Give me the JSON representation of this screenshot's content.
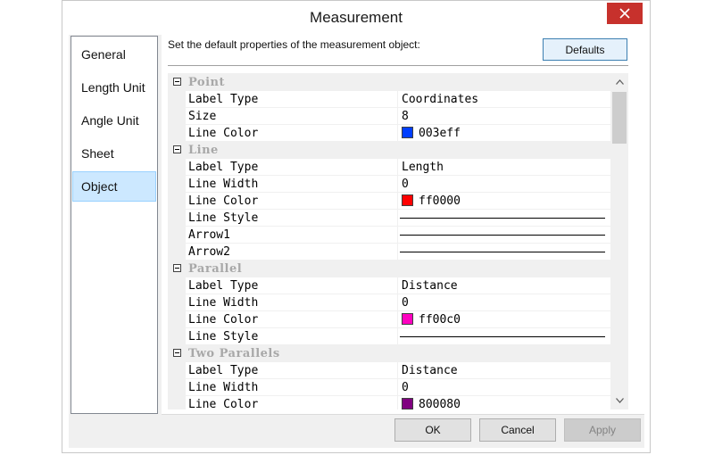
{
  "window": {
    "title": "Measurement"
  },
  "nav": {
    "items": [
      {
        "label": "General",
        "selected": false
      },
      {
        "label": "Length Unit",
        "selected": false
      },
      {
        "label": "Angle Unit",
        "selected": false
      },
      {
        "label": "Sheet",
        "selected": false
      },
      {
        "label": "Object",
        "selected": true
      }
    ]
  },
  "header": {
    "description": "Set the default properties of the measurement object:",
    "defaults_label": "Defaults"
  },
  "property_grid": {
    "rows": [
      {
        "kind": "category",
        "name": "Point"
      },
      {
        "kind": "property",
        "name": "Label Type",
        "value": "Coordinates"
      },
      {
        "kind": "property",
        "name": "Size",
        "value": "8"
      },
      {
        "kind": "property",
        "name": "Line Color",
        "value": "003eff",
        "color": "#003eff"
      },
      {
        "kind": "category",
        "name": "Line"
      },
      {
        "kind": "property",
        "name": "Label Type",
        "value": "Length"
      },
      {
        "kind": "property",
        "name": "Line Width",
        "value": "0"
      },
      {
        "kind": "property",
        "name": "Line Color",
        "value": "ff0000",
        "color": "#ff0000"
      },
      {
        "kind": "property",
        "name": "Line Style",
        "value": "",
        "line": "solid"
      },
      {
        "kind": "property",
        "name": "Arrow1",
        "value": "",
        "line": "solid"
      },
      {
        "kind": "property",
        "name": "Arrow2",
        "value": "",
        "line": "solid"
      },
      {
        "kind": "category",
        "name": "Parallel"
      },
      {
        "kind": "property",
        "name": "Label Type",
        "value": "Distance"
      },
      {
        "kind": "property",
        "name": "Line Width",
        "value": "0"
      },
      {
        "kind": "property",
        "name": "Line Color",
        "value": "ff00c0",
        "color": "#ff00c0"
      },
      {
        "kind": "property",
        "name": "Line Style",
        "value": "",
        "line": "solid"
      },
      {
        "kind": "category",
        "name": "Two Parallels"
      },
      {
        "kind": "property",
        "name": "Label Type",
        "value": "Distance"
      },
      {
        "kind": "property",
        "name": "Line Width",
        "value": "0"
      },
      {
        "kind": "property",
        "name": "Line Color",
        "value": "800080",
        "color": "#800080"
      }
    ]
  },
  "footer": {
    "ok_label": "OK",
    "cancel_label": "Cancel",
    "apply_label": "Apply",
    "apply_enabled": false
  },
  "icons": {
    "close": "close-icon",
    "collapse": "collapse-toggle-icon",
    "scroll_up": "chevron-up-icon",
    "scroll_down": "chevron-down-icon"
  },
  "colors": {
    "close_button": "#c7312c",
    "selected_nav": "#cce8ff",
    "defaults_button": "#e5f1fb"
  }
}
